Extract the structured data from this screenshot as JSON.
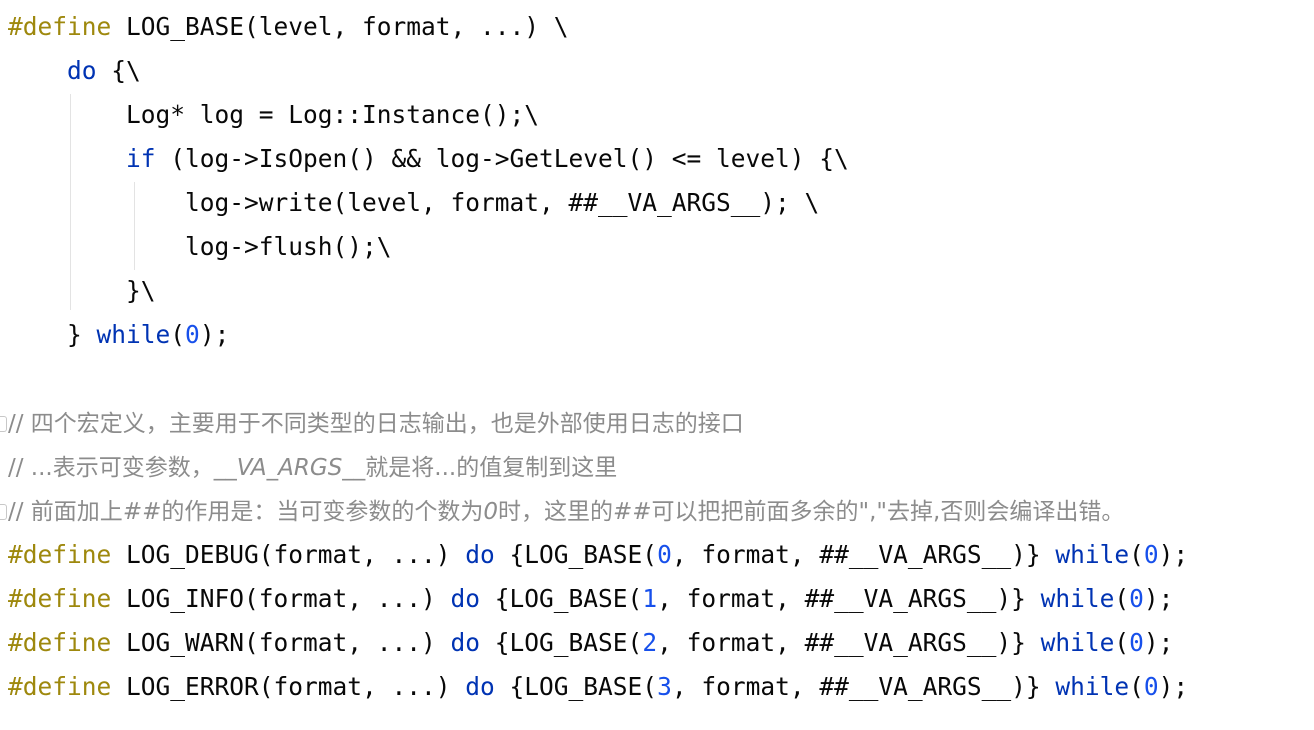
{
  "editor": {
    "lines": [
      [
        {
          "t": "#define",
          "c": "pre"
        },
        {
          "t": " LOG_BASE(level, format, ...) \\",
          "c": "def"
        }
      ],
      [
        {
          "t": "    ",
          "c": "def"
        },
        {
          "t": "do",
          "c": "kw"
        },
        {
          "t": " {\\",
          "c": "def"
        }
      ],
      [
        {
          "t": "        Log* log = Log::Instance();\\",
          "c": "def"
        }
      ],
      [
        {
          "t": "        ",
          "c": "def"
        },
        {
          "t": "if",
          "c": "kw"
        },
        {
          "t": " (log->IsOpen() && log->GetLevel() <= level) {\\",
          "c": "def"
        }
      ],
      [
        {
          "t": "            log->write(level, format, ##__VA_ARGS__); \\",
          "c": "def"
        }
      ],
      [
        {
          "t": "            log->flush();\\",
          "c": "def"
        }
      ],
      [
        {
          "t": "        }\\",
          "c": "def"
        }
      ],
      [
        {
          "t": "    } ",
          "c": "def"
        },
        {
          "t": "while",
          "c": "kw"
        },
        {
          "t": "(",
          "c": "def"
        },
        {
          "t": "0",
          "c": "num"
        },
        {
          "t": ");",
          "c": "def"
        }
      ],
      [],
      [
        {
          "t": "// 四个宏定义，主要用于不同类型的日志输出，也是外部使用日志的接口",
          "c": "cm"
        }
      ],
      [
        {
          "t": "// ...表示可变参数，",
          "c": "cm"
        },
        {
          "t": "__VA_ARGS__",
          "c": "cm cm-i"
        },
        {
          "t": "就是将...的值复制到这里",
          "c": "cm"
        }
      ],
      [
        {
          "t": "// 前面加上",
          "c": "cm"
        },
        {
          "t": "##",
          "c": "cm cm-i"
        },
        {
          "t": "的作用是：当可变参数的个数为",
          "c": "cm"
        },
        {
          "t": "0",
          "c": "cm cm-i"
        },
        {
          "t": "时，这里的",
          "c": "cm"
        },
        {
          "t": "##",
          "c": "cm cm-i"
        },
        {
          "t": "可以把把前面多余的\",\"去掉,否则会编译出错。",
          "c": "cm"
        }
      ],
      [
        {
          "t": "#define",
          "c": "pre"
        },
        {
          "t": " LOG_DEBUG(format, ...) ",
          "c": "def"
        },
        {
          "t": "do",
          "c": "kw"
        },
        {
          "t": " {LOG_BASE(",
          "c": "def"
        },
        {
          "t": "0",
          "c": "num"
        },
        {
          "t": ", format, ##__VA_ARGS__)} ",
          "c": "def"
        },
        {
          "t": "while",
          "c": "kw"
        },
        {
          "t": "(",
          "c": "def"
        },
        {
          "t": "0",
          "c": "num"
        },
        {
          "t": ");",
          "c": "def"
        }
      ],
      [
        {
          "t": "#define",
          "c": "pre"
        },
        {
          "t": " LOG_INFO(format, ...) ",
          "c": "def"
        },
        {
          "t": "do",
          "c": "kw"
        },
        {
          "t": " {LOG_BASE(",
          "c": "def"
        },
        {
          "t": "1",
          "c": "num"
        },
        {
          "t": ", format, ##__VA_ARGS__)} ",
          "c": "def"
        },
        {
          "t": "while",
          "c": "kw"
        },
        {
          "t": "(",
          "c": "def"
        },
        {
          "t": "0",
          "c": "num"
        },
        {
          "t": ");",
          "c": "def"
        }
      ],
      [
        {
          "t": "#define",
          "c": "pre"
        },
        {
          "t": " LOG_WARN(format, ...) ",
          "c": "def"
        },
        {
          "t": "do",
          "c": "kw"
        },
        {
          "t": " {LOG_BASE(",
          "c": "def"
        },
        {
          "t": "2",
          "c": "num"
        },
        {
          "t": ", format, ##__VA_ARGS__)} ",
          "c": "def"
        },
        {
          "t": "while",
          "c": "kw"
        },
        {
          "t": "(",
          "c": "def"
        },
        {
          "t": "0",
          "c": "num"
        },
        {
          "t": ");",
          "c": "def"
        }
      ],
      [
        {
          "t": "#define",
          "c": "pre"
        },
        {
          "t": " LOG_ERROR(format, ...) ",
          "c": "def"
        },
        {
          "t": "do",
          "c": "kw"
        },
        {
          "t": " {LOG_BASE(",
          "c": "def"
        },
        {
          "t": "3",
          "c": "num"
        },
        {
          "t": ", format, ##__VA_ARGS__)} ",
          "c": "def"
        },
        {
          "t": "while",
          "c": "kw"
        },
        {
          "t": "(",
          "c": "def"
        },
        {
          "t": "0",
          "c": "num"
        },
        {
          "t": ");",
          "c": "def"
        }
      ]
    ]
  },
  "colors": {
    "preprocessor": "#9e880d",
    "keyword": "#0033b3",
    "number": "#1750eb",
    "default": "#080808",
    "comment": "#8c8c8c",
    "background": "#ffffff"
  }
}
